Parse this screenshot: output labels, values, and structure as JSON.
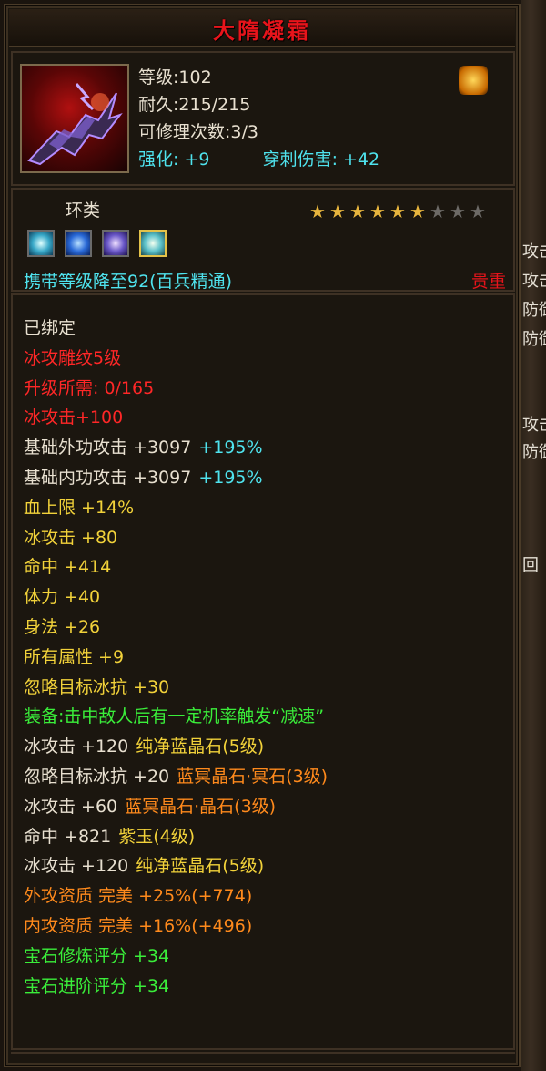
{
  "item": {
    "name": "大隋凝霜",
    "level": "等级:102",
    "durability": "耐久:215/215",
    "repair": "可修理次数:3/3",
    "enhance_label": "强化:",
    "enhance_value": "+9",
    "pierce_label": "穿刺伤害:",
    "pierce_value": "+42",
    "type": "环类",
    "stars": {
      "filled": 6,
      "total": 9
    },
    "level_reduce": "携带等级降至92(百兵精通)",
    "rarity": "贵重"
  },
  "attributes": [
    {
      "text": "已绑定",
      "color": "white"
    },
    {
      "text": "冰攻雕纹5级",
      "color": "red"
    },
    {
      "text": "升级所需: 0/165",
      "color": "red"
    },
    {
      "text": "冰攻击+100",
      "color": "red"
    },
    {
      "text": "基础外功攻击 +3097",
      "extra": "+195%",
      "color": "white"
    },
    {
      "text": "基础内功攻击 +3097",
      "extra": "+195%",
      "color": "white"
    },
    {
      "text": "血上限 +14%",
      "color": "yellow"
    },
    {
      "text": "冰攻击 +80",
      "color": "yellow"
    },
    {
      "text": "命中 +414",
      "color": "yellow"
    },
    {
      "text": "体力 +40",
      "color": "yellow"
    },
    {
      "text": "身法 +26",
      "color": "yellow"
    },
    {
      "text": "所有属性 +9",
      "color": "yellow"
    },
    {
      "text": "忽略目标冰抗 +30",
      "color": "yellow"
    },
    {
      "text": "装备:击中敌人后有一定机率触发“减速”",
      "color": "green"
    },
    {
      "text": "冰攻击 +120",
      "extra": "纯净蓝晶石(5级)",
      "color": "white",
      "extra_color": "yellow"
    },
    {
      "text": "忽略目标冰抗 +20",
      "extra": "蓝冥晶石·冥石(3级)",
      "color": "white",
      "extra_color": "orange"
    },
    {
      "text": "冰攻击 +60",
      "extra": "蓝冥晶石·晶石(3级)",
      "color": "white",
      "extra_color": "orange"
    },
    {
      "text": "命中 +821",
      "extra": "紫玉(4级)",
      "color": "white",
      "extra_color": "yellow"
    },
    {
      "text": "冰攻击 +120",
      "extra": "纯净蓝晶石(5级)",
      "color": "white",
      "extra_color": "yellow"
    },
    {
      "text": "外攻资质  完美 +25%(+774)",
      "color": "orange"
    },
    {
      "text": "内攻资质  完美 +16%(+496)",
      "color": "orange"
    },
    {
      "text": "宝石修炼评分 +34",
      "color": "green"
    },
    {
      "text": "宝石进阶评分 +34",
      "color": "green"
    }
  ],
  "background_fragments": [
    "攻击",
    "攻击",
    "防御",
    "防御",
    "攻击",
    "防御",
    "回"
  ]
}
